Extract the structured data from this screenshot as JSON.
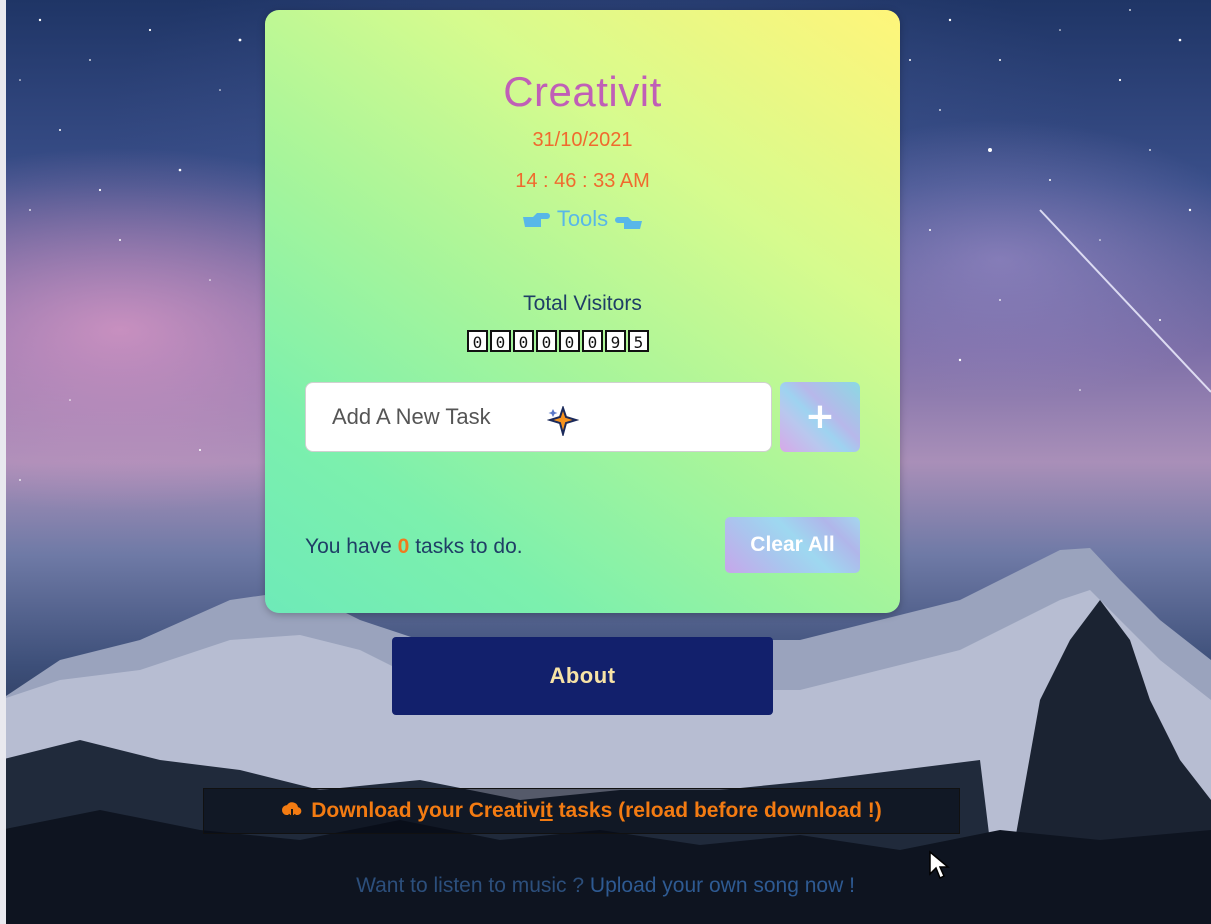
{
  "app": {
    "title": "Creativit",
    "date": "31/10/2021",
    "time": "14 : 46 : 33 AM",
    "tools_label": "Tools"
  },
  "visitors": {
    "label": "Total Visitors",
    "digits": [
      "0",
      "0",
      "0",
      "0",
      "0",
      "0",
      "9",
      "5"
    ]
  },
  "task_input": {
    "placeholder": "Add A New Task",
    "add_button_label": "+"
  },
  "summary": {
    "prefix": "You have",
    "count": "0",
    "suffix": "tasks to do.",
    "clear_button_label": "Clear All"
  },
  "about_button_label": "About",
  "download": {
    "text_before": "Download your Creativ",
    "text_underlined": "it",
    "text_after": " tasks (reload before download !)"
  },
  "music": {
    "prefix": "Want to listen to music ?",
    "link": "Upload your own song now !"
  },
  "icons": {
    "hand_left": "pointing-right-hand-icon",
    "hand_right": "pointing-left-hand-icon",
    "sparkle": "sparkle-icon",
    "cloud": "cloud-download-icon"
  },
  "colors": {
    "title": "#c05fb7",
    "date_time": "#f06a2e",
    "tools": "#58b7e8",
    "about_button_bg": "#12206c",
    "download_text": "#f37b12"
  }
}
